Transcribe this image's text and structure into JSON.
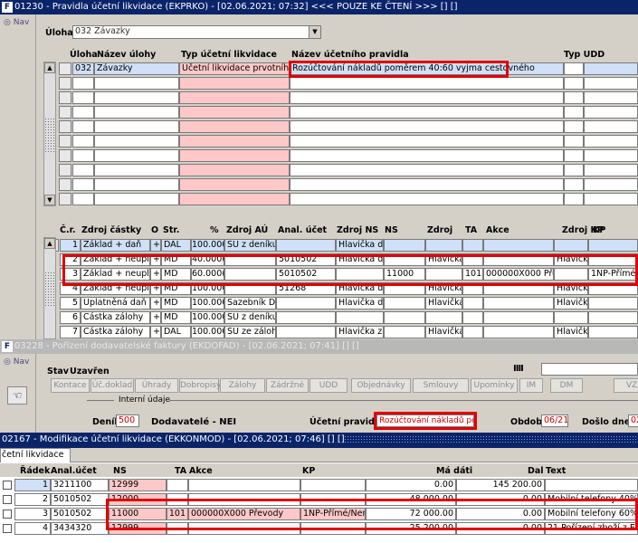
{
  "win1": {
    "title": "01230 - Pravidla účetní likvidace (EKPRKO) - [02.06.2021; 07:32] <<< POUZE KE ČTENÍ >>> [] []",
    "nav": "Nav",
    "uloha_label": "Úloha",
    "uloha_value": "032 Závazky",
    "headers": {
      "uloha": "Úloha",
      "nazev_ulohy": "Název úlohy",
      "typ": "Typ účetní likvidace",
      "nazev_pravidla": "Název účetního pravidla",
      "typ_udd": "Typ UDD"
    },
    "row1": {
      "uloha": "032",
      "nazev": "Závazky",
      "typ": "Účetní likvidace prvotního do",
      "pravidlo": "Rozúčtování nákladů poměrem 40:60 vyjma cestovného"
    },
    "detail_headers": {
      "cr": "Č.r.",
      "zdroj": "Zdroj částky",
      "o": "O",
      "str": "Str.",
      "pct": "%",
      "zdroj_au": "Zdroj AÚ",
      "anal": "Anal. účet",
      "zdroj_ns": "Zdroj NS",
      "ns": "NS",
      "zdroj2": "Zdroj",
      "ta": "TA",
      "akce": "Akce",
      "zdroj_kp": "Zdroj KP",
      "kp": "KP"
    },
    "detail_rows": [
      {
        "cr": "1",
        "zdroj": "Základ + daň",
        "o": "+",
        "str": "DAL",
        "pct": "100.000",
        "zdroj_au": "SÚ z deníku",
        "anal": "",
        "zdroj_ns": "Hlavička do",
        "ns": "",
        "zdroj2": "",
        "ta": "",
        "akce": "",
        "zdroj_kp": "",
        "kp": ""
      },
      {
        "cr": "2",
        "zdroj": "Základ + neuplatr",
        "o": "+",
        "str": "MD",
        "pct": "40.000(",
        "zdroj_au": "",
        "anal": "5010502",
        "zdroj_ns": "Hlavička do",
        "ns": "",
        "zdroj2": "Hlavička",
        "ta": "",
        "akce": "",
        "zdroj_kp": "Hlavička",
        "kp": ""
      },
      {
        "cr": "3",
        "zdroj": "Základ + neuplatr",
        "o": "+",
        "str": "MD",
        "pct": "60.000(",
        "zdroj_au": "",
        "anal": "5010502",
        "zdroj_ns": "",
        "ns": "11000",
        "zdroj2": "",
        "ta": "101",
        "akce": "000000X000 Přev",
        "zdroj_kp": "",
        "kp": "1NP-Přímé/N"
      },
      {
        "cr": "4",
        "zdroj": "Základ + neuplatr",
        "o": "+",
        "str": "MD",
        "pct": "100.000",
        "zdroj_au": "",
        "anal": "51268",
        "zdroj_ns": "Hlavička do",
        "ns": "",
        "zdroj2": "Hlavička",
        "ta": "",
        "akce": "",
        "zdroj_kp": "Hlavička",
        "kp": ""
      },
      {
        "cr": "5",
        "zdroj": "Uplatněná daň",
        "o": "+",
        "str": "MD",
        "pct": "100.000",
        "zdroj_au": "Sazebník DPH",
        "anal": "",
        "zdroj_ns": "Hlavička do",
        "ns": "",
        "zdroj2": "Hlavička",
        "ta": "",
        "akce": "",
        "zdroj_kp": "Hlavička",
        "kp": ""
      },
      {
        "cr": "6",
        "zdroj": "Částka zálohy",
        "o": "+",
        "str": "MD",
        "pct": "100.000",
        "zdroj_au": "SÚ z deníku",
        "anal": "",
        "zdroj_ns": "",
        "ns": "",
        "zdroj2": "",
        "ta": "",
        "akce": "",
        "zdroj_kp": "",
        "kp": ""
      },
      {
        "cr": "7",
        "zdroj": "Částka zálohy",
        "o": "+",
        "str": "DAL",
        "pct": "100.000",
        "zdroj_au": "SÚ ze zálohy",
        "anal": "",
        "zdroj_ns": "Hlavička zá",
        "ns": "",
        "zdroj2": "Hlavička",
        "ta": "",
        "akce": "",
        "zdroj_kp": "Hlavička",
        "kp": ""
      }
    ]
  },
  "win2": {
    "title": "03228 - Pořízení dodavatelské faktury (EKDOFAD) - [02.06.2021; 07:41] [] []",
    "nav": "Nav",
    "stav_label": "Stav",
    "stav_value": "Uzavřen",
    "buttons": [
      "Kontace",
      "Úč.doklad",
      "Úhrady",
      "Dobropisy",
      "Zálohy",
      "Zádržné",
      "UDD",
      "Objednávky",
      "Smlouvy",
      "Upomínky",
      "IM",
      "DM",
      "VZ"
    ],
    "interni_udaje": "Interní údaje",
    "denik_label": "Deník",
    "denik_value": "500",
    "dodavatele": "Dodavatelé - NEI",
    "pravidlo_label": "Účetní pravidlo",
    "pravidlo_value": "Rozúčtování nákladů pom",
    "obdobi_label": "Období",
    "obdobi_value": "06/21",
    "doslo_label": "Došlo dne",
    "doslo_value": "02"
  },
  "win3": {
    "title": "02167 - Modifikace účetní likvidace (EKKONMOD) - [02.06.2021; 07:46] [] []",
    "tab": "četní likvidace",
    "headers": {
      "radek": "Řádek",
      "anal": "Anal.účet",
      "ns": "NS",
      "ta": "TA",
      "akce": "Akce",
      "kp": "KP",
      "ma_dati": "Má dáti",
      "dal": "Dal",
      "text": "Text"
    },
    "rows": [
      {
        "radek": "1",
        "anal": "3211100",
        "ns": "12999",
        "ta": "",
        "akce": "",
        "kp": "",
        "ma_dati": "0.00",
        "dal": "145 200.00",
        "text": ""
      },
      {
        "radek": "2",
        "anal": "5010502",
        "ns": "12000",
        "ta": "",
        "akce": "",
        "kp": "",
        "ma_dati": "48 000.00",
        "dal": "0.00",
        "text": "Mobilní telefony 40% h"
      },
      {
        "radek": "3",
        "anal": "5010502",
        "ns": "11000",
        "ta": "101",
        "akce": "000000X000 Převody",
        "kp": "1NP-Přímé/Nero",
        "ma_dati": "72 000.00",
        "dal": "0.00",
        "text": "Mobilní telefony 60% h"
      },
      {
        "radek": "4",
        "anal": "3434320",
        "ns": "12999",
        "ta": "",
        "akce": "",
        "kp": "",
        "ma_dati": "25 200.00",
        "dal": "0.00",
        "text": "21  Pořízení zboží z EU"
      }
    ]
  }
}
